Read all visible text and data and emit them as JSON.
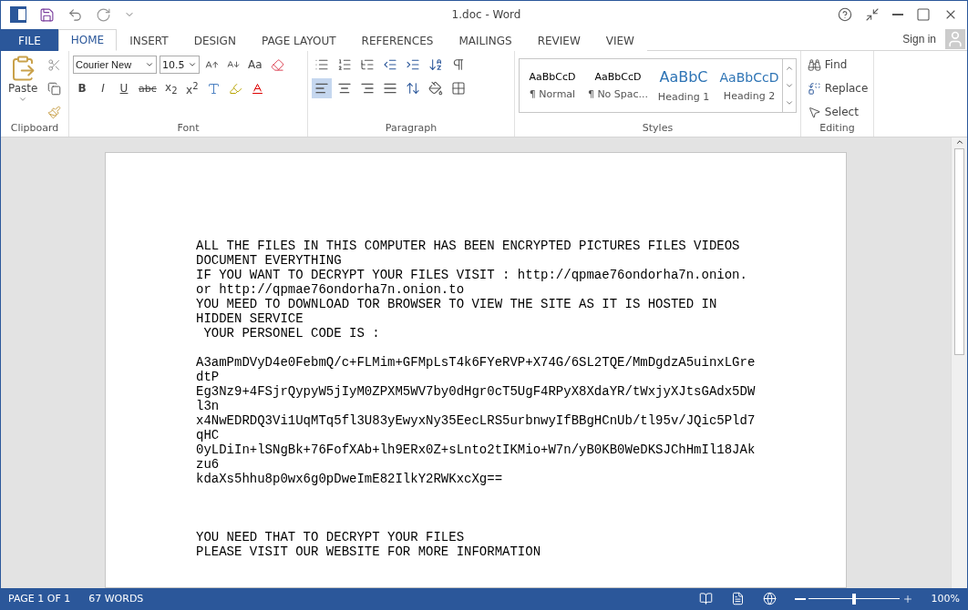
{
  "window": {
    "title": "1.doc - Word"
  },
  "tabs": [
    {
      "label": "FILE",
      "kind": "file",
      "selected": false
    },
    {
      "label": "HOME",
      "kind": "tab",
      "selected": true
    },
    {
      "label": "INSERT",
      "kind": "tab",
      "selected": false
    },
    {
      "label": "DESIGN",
      "kind": "tab",
      "selected": false
    },
    {
      "label": "PAGE LAYOUT",
      "kind": "tab",
      "selected": false
    },
    {
      "label": "REFERENCES",
      "kind": "tab",
      "selected": false
    },
    {
      "label": "MAILINGS",
      "kind": "tab",
      "selected": false
    },
    {
      "label": "REVIEW",
      "kind": "tab",
      "selected": false
    },
    {
      "label": "VIEW",
      "kind": "tab",
      "selected": false
    }
  ],
  "sign_in": "Sign in",
  "ribbon": {
    "clipboard": {
      "label": "Clipboard",
      "paste": "Paste"
    },
    "font": {
      "label": "Font",
      "font_name": "Courier New",
      "font_size": "10.5",
      "change_case": "Aa",
      "bold": "B",
      "italic": "I",
      "underline": "U",
      "strikethrough": "abc",
      "subscript": "x$_{2}$",
      "superscript": "x$^{2}$"
    },
    "paragraph": {
      "label": "Paragraph",
      "alignments": [
        {
          "selected": true
        },
        {
          "selected": false
        },
        {
          "selected": false
        },
        {
          "selected": false
        }
      ]
    },
    "styles": {
      "label": "Styles",
      "items": [
        {
          "preview": "AaBbCcD",
          "name": "¶ Normal",
          "kind": "body"
        },
        {
          "preview": "AaBbCcD",
          "name": "¶ No Spac...",
          "kind": "body"
        },
        {
          "preview": "AaBbC",
          "name": "Heading 1",
          "kind": "heading1"
        },
        {
          "preview": "AaBbCcD",
          "name": "Heading 2",
          "kind": "heading2"
        }
      ]
    },
    "editing": {
      "label": "Editing",
      "find": "Find",
      "replace": "Replace",
      "select": "Select"
    }
  },
  "document": {
    "blocks": [
      {
        "kind": "intro",
        "lines": [
          "ALL THE FILES IN THIS COMPUTER HAS BEEN ENCRYPTED PICTURES FILES VIDEOS",
          "DOCUMENT EVERYTHING",
          "IF YOU WANT TO DECRYPT YOUR FILES VISIT : http://qpmae76ondorha7n.onion.",
          "or http://qpmae76ondorha7n.onion.to",
          "YOU MEED TO DOWNLOAD TOR BROWSER TO VIEW THE SITE AS IT IS HOSTED IN",
          "HIDDEN SERVICE",
          " YOUR PERSONEL CODE IS :"
        ]
      },
      {
        "kind": "code",
        "lines": [
          "A3amPmDVyD4e0FebmQ/c+FLMim+GFMpLsT4k6FYeRVP+X74G/6SL2TQE/MmDgdzA5uinxLGre",
          "dtP",
          "Eg3Nz9+4FSjrQypyW5jIyM0ZPXM5WV7by0dHgr0cT5UgF4RPyX8XdaYR/tWxjyXJtsGAdx5DW",
          "l3n",
          "x4NwEDRDQ3Vi1UqMTq5fl3U83yEwyxNy35EecLRS5urbnwyIfBBgHCnUb/tl95v/JQic5Pld7",
          "qHC",
          "0yLDiIn+lSNgBk+76FofXAb+lh9ERx0Z+sLnto2tIKMio+W7n/yB0KB0WeDKSJChHmIl18JAk",
          "zu6",
          "kdaXs5hhu8p0wx6g0pDweImE82IlkY2RWKxcXg=="
        ]
      },
      {
        "kind": "closing",
        "lines": [
          "YOU NEED THAT TO DECRYPT YOUR FILES",
          "PLEASE VISIT OUR WEBSITE FOR MORE INFORMATION"
        ]
      }
    ]
  },
  "status_bar": {
    "page": "PAGE 1 OF 1",
    "words": "67 WORDS",
    "zoom": {
      "level": 0.5,
      "reading": "100%"
    }
  }
}
